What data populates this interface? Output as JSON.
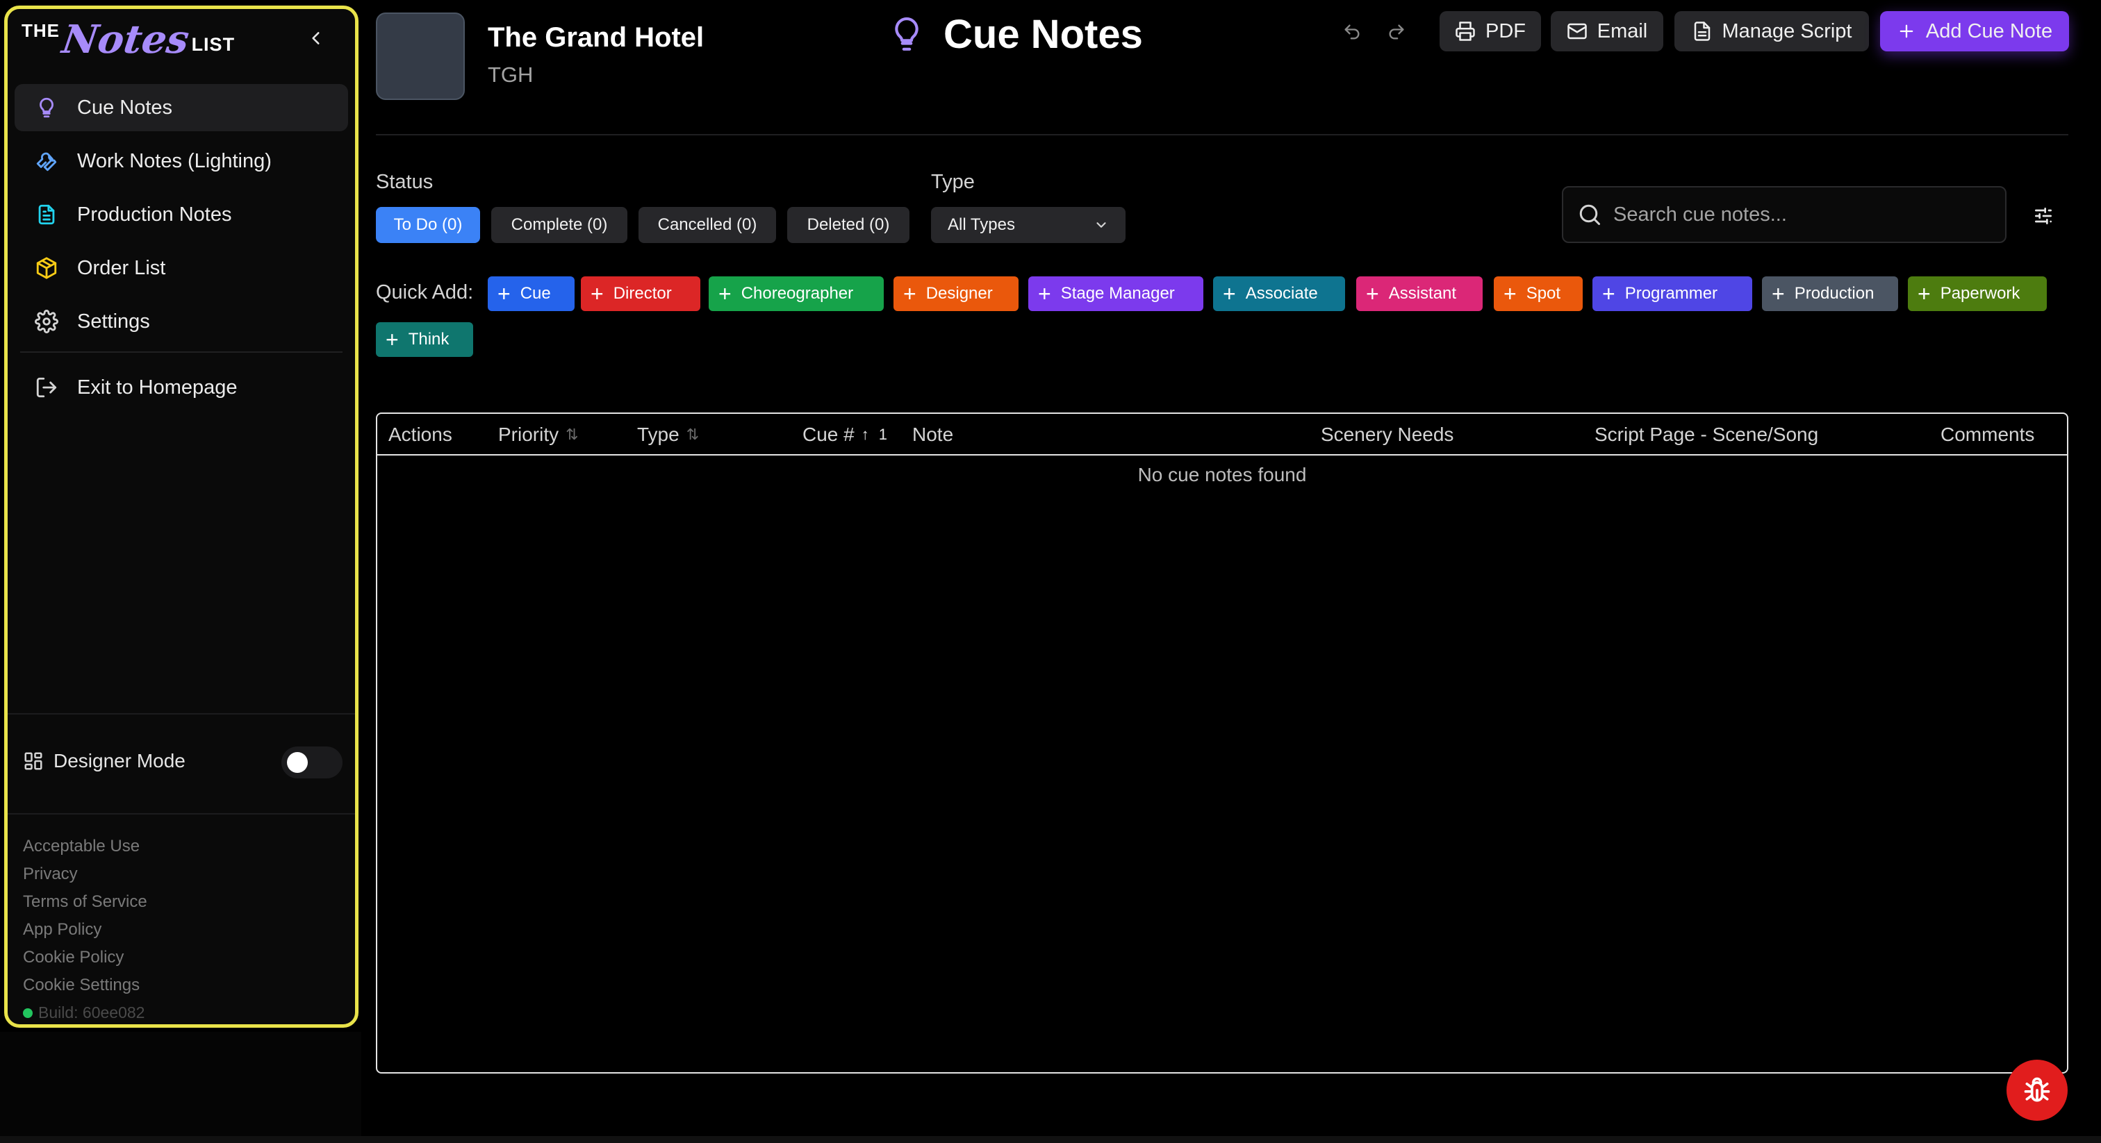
{
  "app": {
    "logo_the": "THE",
    "logo_notes": "Notes",
    "logo_list": "LIST",
    "build": "Build: 60ee082"
  },
  "sidebar": {
    "items": [
      {
        "label": "Cue Notes",
        "icon": "lightbulb-icon",
        "active": true
      },
      {
        "label": "Work Notes (Lighting)",
        "icon": "wrench-icon"
      },
      {
        "label": "Production Notes",
        "icon": "document-icon"
      },
      {
        "label": "Order List",
        "icon": "package-icon"
      },
      {
        "label": "Settings",
        "icon": "gear-icon"
      }
    ],
    "exit_label": "Exit to Homepage",
    "designer_mode_label": "Designer Mode",
    "designer_mode_on": false,
    "footer_links": [
      "Acceptable Use",
      "Privacy",
      "Terms of Service",
      "App Policy",
      "Cookie Policy",
      "Cookie Settings"
    ]
  },
  "header": {
    "show_title": "The Grand Hotel",
    "show_abbr": "TGH",
    "page_title": "Cue Notes",
    "buttons": {
      "pdf": "PDF",
      "email": "Email",
      "manage_script": "Manage Script",
      "add_cue_note": "Add Cue Note"
    }
  },
  "filters": {
    "status_label": "Status",
    "type_label": "Type",
    "status_options": [
      "To Do (0)",
      "Complete (0)",
      "Cancelled (0)",
      "Deleted (0)"
    ],
    "type_value": "All Types",
    "search_placeholder": "Search cue notes..."
  },
  "quick_add": {
    "label": "Quick Add:",
    "items": [
      {
        "label": "Cue",
        "color": "#2563eb"
      },
      {
        "label": "Director",
        "color": "#dc2626"
      },
      {
        "label": "Choreographer",
        "color": "#16a34a"
      },
      {
        "label": "Designer",
        "color": "#ea580c"
      },
      {
        "label": "Stage Manager",
        "color": "#7c3aed"
      },
      {
        "label": "Associate",
        "color": "#0e7490"
      },
      {
        "label": "Assistant",
        "color": "#db2777"
      },
      {
        "label": "Spot",
        "color": "#ea580c"
      },
      {
        "label": "Programmer",
        "color": "#4f46e5"
      },
      {
        "label": "Production",
        "color": "#4b5563"
      },
      {
        "label": "Paperwork",
        "color": "#4d7c0f"
      },
      {
        "label": "Think",
        "color": "#0f766e"
      }
    ]
  },
  "table": {
    "columns": [
      "Actions",
      "Priority",
      "Type",
      "Cue #",
      "Note",
      "Scenery Needs",
      "Script Page - Scene/Song",
      "Comments"
    ],
    "cue_sort_badge": "1",
    "empty_text": "No cue notes found"
  },
  "colors": {
    "accent": "#7c3aed",
    "active_filter": "#3b82f6",
    "sidebar_border": "#e9e34a",
    "bug_button": "#e11d1d"
  }
}
